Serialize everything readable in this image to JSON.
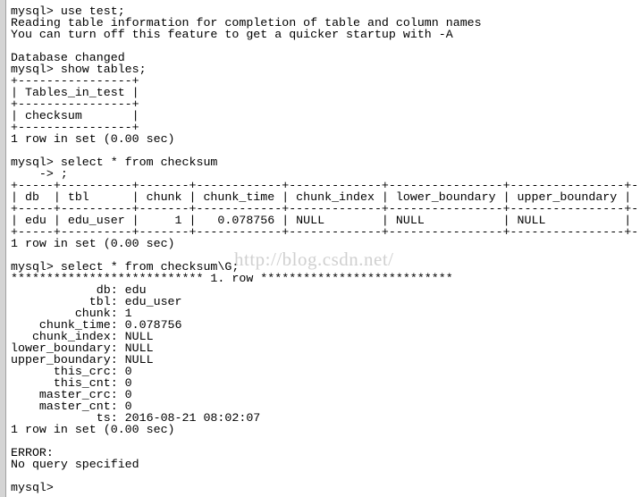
{
  "terminal": {
    "lines": [
      "mysql> use test;",
      "Reading table information for completion of table and column names",
      "You can turn off this feature to get a quicker startup with -A",
      "",
      "Database changed",
      "mysql> show tables;",
      "+----------------+",
      "| Tables_in_test |",
      "+----------------+",
      "| checksum       |",
      "+----------------+",
      "1 row in set (0.00 sec)",
      "",
      "mysql> select * from checksum",
      "    -> ;",
      "+-----+----------+-------+------------+-------------+----------------+----------------+-",
      "| db  | tbl      | chunk | chunk_time | chunk_index | lower_boundary | upper_boundary |",
      "+-----+----------+-------+------------+-------------+----------------+----------------+-",
      "| edu | edu_user |     1 |   0.078756 | NULL        | NULL           | NULL           |",
      "+-----+----------+-------+------------+-------------+----------------+----------------+-",
      "1 row in set (0.00 sec)",
      "",
      "mysql> select * from checksum\\G;",
      "*************************** 1. row ***************************",
      "            db: edu",
      "           tbl: edu_user",
      "         chunk: 1",
      "    chunk_time: 0.078756",
      "   chunk_index: NULL",
      "lower_boundary: NULL",
      "upper_boundary: NULL",
      "      this_crc: 0",
      "      this_cnt: 0",
      "    master_crc: 0",
      "    master_cnt: 0",
      "            ts: 2016-08-21 08:02:07",
      "1 row in set (0.00 sec)",
      "",
      "ERROR:",
      "No query specified",
      "",
      "mysql> "
    ]
  },
  "watermark": "http://blog.csdn.net/"
}
